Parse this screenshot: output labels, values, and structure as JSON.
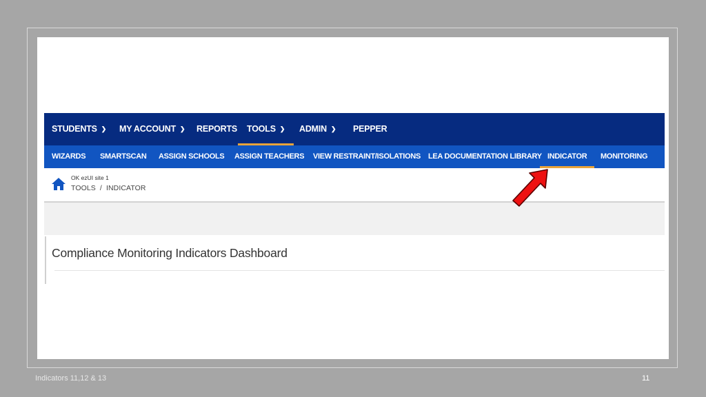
{
  "top_nav": {
    "items": [
      {
        "label": "STUDENTS",
        "has_dropdown": true
      },
      {
        "label": "MY ACCOUNT",
        "has_dropdown": true
      },
      {
        "label": "REPORTS",
        "has_dropdown": false
      },
      {
        "label": "TOOLS",
        "has_dropdown": true,
        "active": true
      },
      {
        "label": "ADMIN",
        "has_dropdown": true
      },
      {
        "label": "PEPPER",
        "has_dropdown": false
      }
    ],
    "dropdown_icon": "chevron-down-icon",
    "active_underline_color": "#e9a43a",
    "background_color": "#062b80"
  },
  "sub_nav": {
    "items": [
      {
        "label": "WIZARDS"
      },
      {
        "label": "SMARTSCAN"
      },
      {
        "label": "ASSIGN SCHOOLS"
      },
      {
        "label": "ASSIGN TEACHERS"
      },
      {
        "label": "VIEW RESTRAINT/ISOLATIONS"
      },
      {
        "label": "LEA DOCUMENTATION LIBRARY"
      },
      {
        "label": "INDICATOR",
        "active": true
      },
      {
        "label": "MONITORING"
      }
    ],
    "background_color": "#1155c1"
  },
  "breadcrumb": {
    "home_icon": "home-icon",
    "site_name": "OK ezUI site 1",
    "path": [
      "TOOLS",
      "INDICATOR"
    ],
    "separator": "/"
  },
  "main": {
    "title": "Compliance Monitoring Indicators Dashboard"
  },
  "annotation": {
    "icon": "red-arrow-icon",
    "points_to": "INDICATOR",
    "color": "#ee1111"
  },
  "footer": {
    "text": "Indicators 11,12 & 13",
    "page_number": "11"
  }
}
